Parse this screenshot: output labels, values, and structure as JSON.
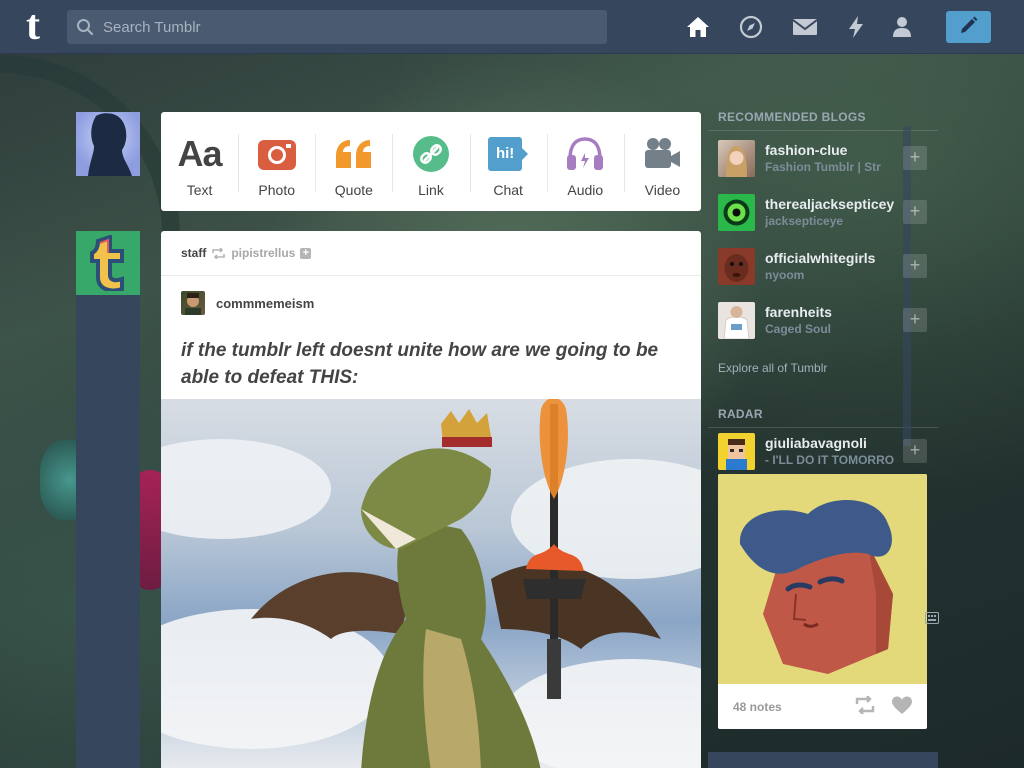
{
  "header": {
    "search_placeholder": "Search Tumblr",
    "logo": "t",
    "nav_icons": [
      "home-icon",
      "explore-icon",
      "inbox-icon",
      "activity-icon",
      "account-icon"
    ],
    "compose_icon": "pencil-icon"
  },
  "post_types": [
    {
      "label": "Text",
      "icon": "text-icon",
      "glyph": "Aa",
      "color": "#444444"
    },
    {
      "label": "Photo",
      "icon": "camera-icon",
      "color": "#d95e40"
    },
    {
      "label": "Quote",
      "icon": "quote-icon",
      "color": "#f2992e"
    },
    {
      "label": "Link",
      "icon": "link-icon",
      "color": "#56bc8a"
    },
    {
      "label": "Chat",
      "icon": "chat-icon",
      "glyph": "hi!",
      "color": "#529ecc"
    },
    {
      "label": "Audio",
      "icon": "headphones-icon",
      "color": "#a77dc2"
    },
    {
      "label": "Video",
      "icon": "video-camera-icon",
      "color": "#748089"
    }
  ],
  "post": {
    "author": "staff",
    "reblogged_from": "pipistrellus",
    "trail_author": "commmemeism",
    "text": "if the tumblr left doesnt unite how are we going to be able to defeat THIS:"
  },
  "sidebar": {
    "recommended_heading": "RECOMMENDED BLOGS",
    "blogs": [
      {
        "name": "fashion-clue",
        "subtitle": "Fashion Tumblr | Str"
      },
      {
        "name": "therealjacksepticey",
        "subtitle": "jacksepticeye"
      },
      {
        "name": "officialwhitegirls",
        "subtitle": "nyoom"
      },
      {
        "name": "farenheits",
        "subtitle": "Caged Soul"
      }
    ],
    "explore_link": "Explore all of Tumblr",
    "radar_heading": "RADAR",
    "radar": {
      "name": "giuliabavagnoli",
      "subtitle": "- I'LL DO IT TOMORRO",
      "notes": "48 notes"
    }
  },
  "colors": {
    "header_bg": "#36465d",
    "compose_bg": "#529ecc",
    "staff_avatar": "#38a86a",
    "radar_bg": "#e3d97a"
  }
}
